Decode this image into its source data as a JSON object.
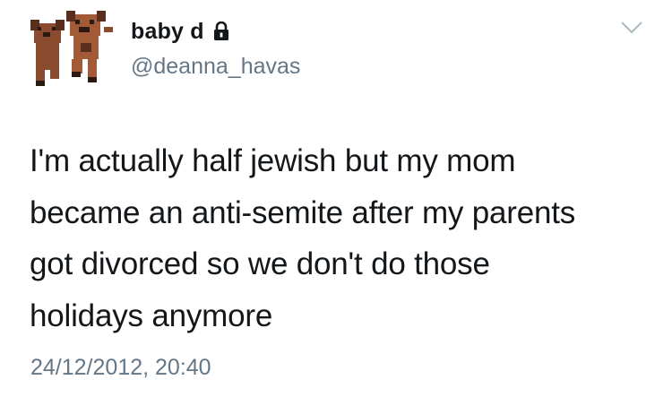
{
  "user": {
    "display_name": "baby d",
    "handle": "@deanna_havas",
    "protected_icon": "lock-icon",
    "avatar_icon": "dog-cartoon-avatar"
  },
  "menu": {
    "icon": "chevron-down-icon"
  },
  "tweet": {
    "lines": [
      "I'm actually half jewish but my mom",
      "became an anti-semite after my parents",
      "got divorced so we don't do those",
      "holidays anymore"
    ],
    "timestamp": "24/12/2012, 20:40"
  },
  "colors": {
    "text": "#14171a",
    "secondary": "#657786",
    "avatar_brown": "#8a4b2f",
    "avatar_dark": "#2b1a12"
  }
}
